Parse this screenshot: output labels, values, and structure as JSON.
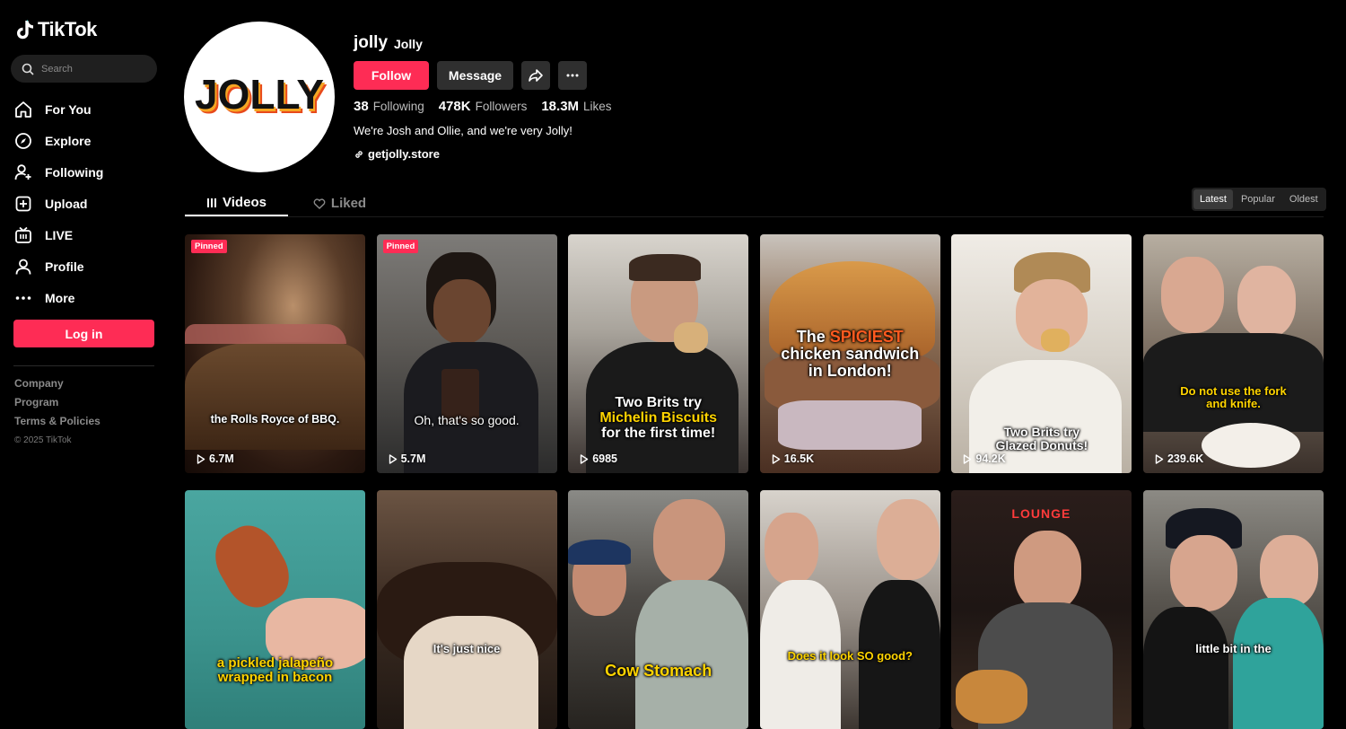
{
  "brand": {
    "name": "TikTok"
  },
  "search": {
    "placeholder": "Search"
  },
  "nav": [
    {
      "label": "For You",
      "icon": "home-icon"
    },
    {
      "label": "Explore",
      "icon": "compass-icon"
    },
    {
      "label": "Following",
      "icon": "following-icon"
    },
    {
      "label": "Upload",
      "icon": "upload-icon"
    },
    {
      "label": "LIVE",
      "icon": "live-icon"
    },
    {
      "label": "Profile",
      "icon": "profile-icon"
    },
    {
      "label": "More",
      "icon": "more-icon"
    }
  ],
  "login_label": "Log in",
  "footer": {
    "company": "Company",
    "program": "Program",
    "terms": "Terms & Policies",
    "copyright": "© 2025 TikTok"
  },
  "profile": {
    "avatar_text": "JOLLY",
    "username": "jolly",
    "nickname": "Jolly",
    "follow_label": "Follow",
    "message_label": "Message",
    "following_count": "38",
    "following_label": "Following",
    "followers_count": "478K",
    "followers_label": "Followers",
    "likes_count": "18.3M",
    "likes_label": "Likes",
    "bio": "We're Josh and Ollie, and we're very Jolly!",
    "link": "getjolly.store"
  },
  "tabs": {
    "videos": "Videos",
    "liked": "Liked"
  },
  "sort": {
    "latest": "Latest",
    "popular": "Popular",
    "oldest": "Oldest"
  },
  "colors": {
    "accent": "#fe2c55",
    "caption_yellow": "#ffd400"
  },
  "videos": [
    {
      "pinned": "Pinned",
      "caption": "the Rolls Royce of BBQ.",
      "views": "6.7M"
    },
    {
      "pinned": "Pinned",
      "caption": "Oh, that's so good.",
      "views": "5.7M"
    },
    {
      "caption_1": "Two Brits try",
      "caption_2": "Michelin Biscuits",
      "caption_3": "for the first time!",
      "views": "6985"
    },
    {
      "caption_1": "The",
      "caption_2": "SPICIEST",
      "caption_3": "chicken sandwich",
      "caption_4": "in London!",
      "views": "16.5K"
    },
    {
      "caption_1": "Two Brits try",
      "caption_2": "Glazed Donuts!",
      "views": "94.2K"
    },
    {
      "caption_1": "Do not use the fork",
      "caption_2": "and knife.",
      "views": "239.6K"
    },
    {
      "caption_1": "a pickled jalapeño",
      "caption_2": "wrapped in bacon"
    },
    {
      "caption": "It's just nice"
    },
    {
      "caption": "Cow Stomach"
    },
    {
      "caption": "Does it look SO good?"
    },
    {
      "sign": "LOUNGE"
    },
    {
      "caption": "little bit in the"
    }
  ]
}
